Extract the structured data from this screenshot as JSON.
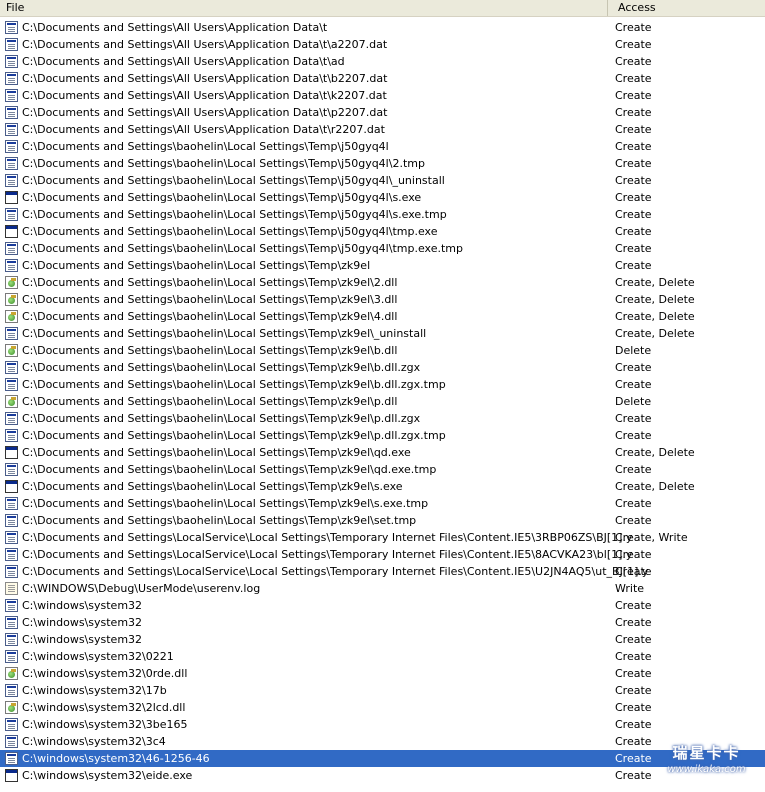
{
  "header": {
    "file_label": "File",
    "access_label": "Access"
  },
  "rows": [
    {
      "path": "C:\\Documents and Settings\\All Users\\Application Data\\t",
      "access": "Create",
      "icon": "doc"
    },
    {
      "path": "C:\\Documents and Settings\\All Users\\Application Data\\t\\a2207.dat",
      "access": "Create",
      "icon": "doc"
    },
    {
      "path": "C:\\Documents and Settings\\All Users\\Application Data\\t\\ad",
      "access": "Create",
      "icon": "doc"
    },
    {
      "path": "C:\\Documents and Settings\\All Users\\Application Data\\t\\b2207.dat",
      "access": "Create",
      "icon": "doc"
    },
    {
      "path": "C:\\Documents and Settings\\All Users\\Application Data\\t\\k2207.dat",
      "access": "Create",
      "icon": "doc"
    },
    {
      "path": "C:\\Documents and Settings\\All Users\\Application Data\\t\\p2207.dat",
      "access": "Create",
      "icon": "doc"
    },
    {
      "path": "C:\\Documents and Settings\\All Users\\Application Data\\t\\r2207.dat",
      "access": "Create",
      "icon": "doc"
    },
    {
      "path": "C:\\Documents and Settings\\baohelin\\Local Settings\\Temp\\j50gyq4l",
      "access": "Create",
      "icon": "doc"
    },
    {
      "path": "C:\\Documents and Settings\\baohelin\\Local Settings\\Temp\\j50gyq4l\\2.tmp",
      "access": "Create",
      "icon": "doc"
    },
    {
      "path": "C:\\Documents and Settings\\baohelin\\Local Settings\\Temp\\j50gyq4l\\_uninstall",
      "access": "Create",
      "icon": "doc"
    },
    {
      "path": "C:\\Documents and Settings\\baohelin\\Local Settings\\Temp\\j50gyq4l\\s.exe",
      "access": "Create",
      "icon": "exe"
    },
    {
      "path": "C:\\Documents and Settings\\baohelin\\Local Settings\\Temp\\j50gyq4l\\s.exe.tmp",
      "access": "Create",
      "icon": "doc"
    },
    {
      "path": "C:\\Documents and Settings\\baohelin\\Local Settings\\Temp\\j50gyq4l\\tmp.exe",
      "access": "Create",
      "icon": "exe"
    },
    {
      "path": "C:\\Documents and Settings\\baohelin\\Local Settings\\Temp\\j50gyq4l\\tmp.exe.tmp",
      "access": "Create",
      "icon": "doc"
    },
    {
      "path": "C:\\Documents and Settings\\baohelin\\Local Settings\\Temp\\zk9el",
      "access": "Create",
      "icon": "doc"
    },
    {
      "path": "C:\\Documents and Settings\\baohelin\\Local Settings\\Temp\\zk9el\\2.dll",
      "access": "Create, Delete",
      "icon": "dll"
    },
    {
      "path": "C:\\Documents and Settings\\baohelin\\Local Settings\\Temp\\zk9el\\3.dll",
      "access": "Create, Delete",
      "icon": "dll"
    },
    {
      "path": "C:\\Documents and Settings\\baohelin\\Local Settings\\Temp\\zk9el\\4.dll",
      "access": "Create, Delete",
      "icon": "dll"
    },
    {
      "path": "C:\\Documents and Settings\\baohelin\\Local Settings\\Temp\\zk9el\\_uninstall",
      "access": "Create, Delete",
      "icon": "doc"
    },
    {
      "path": "C:\\Documents and Settings\\baohelin\\Local Settings\\Temp\\zk9el\\b.dll",
      "access": "Delete",
      "icon": "dll"
    },
    {
      "path": "C:\\Documents and Settings\\baohelin\\Local Settings\\Temp\\zk9el\\b.dll.zgx",
      "access": "Create",
      "icon": "doc"
    },
    {
      "path": "C:\\Documents and Settings\\baohelin\\Local Settings\\Temp\\zk9el\\b.dll.zgx.tmp",
      "access": "Create",
      "icon": "doc"
    },
    {
      "path": "C:\\Documents and Settings\\baohelin\\Local Settings\\Temp\\zk9el\\p.dll",
      "access": "Delete",
      "icon": "dll"
    },
    {
      "path": "C:\\Documents and Settings\\baohelin\\Local Settings\\Temp\\zk9el\\p.dll.zgx",
      "access": "Create",
      "icon": "doc"
    },
    {
      "path": "C:\\Documents and Settings\\baohelin\\Local Settings\\Temp\\zk9el\\p.dll.zgx.tmp",
      "access": "Create",
      "icon": "doc"
    },
    {
      "path": "C:\\Documents and Settings\\baohelin\\Local Settings\\Temp\\zk9el\\qd.exe",
      "access": "Create, Delete",
      "icon": "exe"
    },
    {
      "path": "C:\\Documents and Settings\\baohelin\\Local Settings\\Temp\\zk9el\\qd.exe.tmp",
      "access": "Create",
      "icon": "doc"
    },
    {
      "path": "C:\\Documents and Settings\\baohelin\\Local Settings\\Temp\\zk9el\\s.exe",
      "access": "Create, Delete",
      "icon": "exe"
    },
    {
      "path": "C:\\Documents and Settings\\baohelin\\Local Settings\\Temp\\zk9el\\s.exe.tmp",
      "access": "Create",
      "icon": "doc"
    },
    {
      "path": "C:\\Documents and Settings\\baohelin\\Local Settings\\Temp\\zk9el\\set.tmp",
      "access": "Create",
      "icon": "doc"
    },
    {
      "path": "C:\\Documents and Settings\\LocalService\\Local Settings\\Temporary Internet Files\\Content.IE5\\3RBP06ZS\\BJ[1].y",
      "access": "Create, Write",
      "icon": "doc"
    },
    {
      "path": "C:\\Documents and Settings\\LocalService\\Local Settings\\Temporary Internet Files\\Content.IE5\\8ACVKA23\\bl[1].y",
      "access": "Create",
      "icon": "doc"
    },
    {
      "path": "C:\\Documents and Settings\\LocalService\\Local Settings\\Temporary Internet Files\\Content.IE5\\U2JN4AQ5\\ut_BJ[1].y",
      "access": "Create",
      "icon": "doc"
    },
    {
      "path": "C:\\WINDOWS\\Debug\\UserMode\\userenv.log",
      "access": "Write",
      "icon": "log"
    },
    {
      "path": "C:\\windows\\system32",
      "access": "Create",
      "icon": "doc"
    },
    {
      "path": "C:\\windows\\system32",
      "access": "Create",
      "icon": "doc"
    },
    {
      "path": "C:\\windows\\system32",
      "access": "Create",
      "icon": "doc"
    },
    {
      "path": "C:\\windows\\system32\\0221",
      "access": "Create",
      "icon": "doc"
    },
    {
      "path": "C:\\windows\\system32\\0rde.dll",
      "access": "Create",
      "icon": "dll"
    },
    {
      "path": "C:\\windows\\system32\\17b",
      "access": "Create",
      "icon": "doc"
    },
    {
      "path": "C:\\windows\\system32\\2lcd.dll",
      "access": "Create",
      "icon": "dll"
    },
    {
      "path": "C:\\windows\\system32\\3be165",
      "access": "Create",
      "icon": "doc"
    },
    {
      "path": "C:\\windows\\system32\\3c4",
      "access": "Create",
      "icon": "doc"
    },
    {
      "path": "C:\\windows\\system32\\46-1256-46",
      "access": "Create",
      "icon": "doc",
      "selected": true
    },
    {
      "path": "C:\\windows\\system32\\eide.exe",
      "access": "Create",
      "icon": "exe"
    }
  ],
  "watermark": {
    "line1": "瑞星卡卡",
    "line2": "www.ikaka.com"
  }
}
